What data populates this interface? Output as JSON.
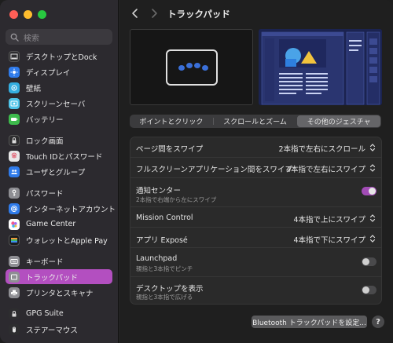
{
  "window": {
    "title": "トラックパッド"
  },
  "sidebar": {
    "search_placeholder": "検索",
    "items": [
      {
        "label": "デスクトップとDock",
        "icon": "dock-icon",
        "color": "#2d2d2f"
      },
      {
        "label": "ディスプレイ",
        "icon": "display-icon",
        "color": "#2f7bea"
      },
      {
        "label": "壁紙",
        "icon": "wallpaper-icon",
        "color": "#34aee0"
      },
      {
        "label": "スクリーンセーバ",
        "icon": "screensaver-icon",
        "color": "#4fc4e8"
      },
      {
        "label": "バッテリー",
        "icon": "battery-icon",
        "color": "#3dbb4c"
      },
      {
        "label": "ロック画面",
        "icon": "lock-icon",
        "color": "#2d2d2f"
      },
      {
        "label": "Touch IDとパスワード",
        "icon": "fingerprint-icon",
        "color": "#e8e8e8"
      },
      {
        "label": "ユーザとグループ",
        "icon": "users-icon",
        "color": "#2f7bea"
      },
      {
        "label": "パスワード",
        "icon": "key-icon",
        "color": "#8e8e93"
      },
      {
        "label": "インターネットアカウント",
        "icon": "at-icon",
        "color": "#2f7bea"
      },
      {
        "label": "Game Center",
        "icon": "game-center-icon",
        "color": "#ffffff"
      },
      {
        "label": "ウォレットとApple Pay",
        "icon": "wallet-icon",
        "color": "#1c1c1e"
      },
      {
        "label": "キーボード",
        "icon": "keyboard-icon",
        "color": "#8e8e93"
      },
      {
        "label": "トラックパッド",
        "icon": "trackpad-icon",
        "color": "#8e8e93",
        "active": true
      },
      {
        "label": "プリンタとスキャナ",
        "icon": "printer-icon",
        "color": "#8e8e93"
      },
      {
        "label": "GPG Suite",
        "icon": "gpg-lock-icon",
        "color": "#2d2d2f"
      },
      {
        "label": "ステアーマウス",
        "icon": "mouse-icon",
        "color": "#2d2d2f"
      }
    ]
  },
  "tabs": [
    {
      "label": "ポイントとクリック",
      "active": false
    },
    {
      "label": "スクロールとズーム",
      "active": false
    },
    {
      "label": "その他のジェスチャ",
      "active": true
    }
  ],
  "settings": [
    {
      "label": "ページ間をスワイプ",
      "value": "2本指で左右にスクロール",
      "type": "popup"
    },
    {
      "label": "フルスクリーンアプリケーション間をスワイプ",
      "value": "4本指で左右にスワイプ",
      "type": "popup"
    },
    {
      "label": "通知センター",
      "sub": "2本指で右端から左にスワイプ",
      "type": "toggle",
      "on": true
    },
    {
      "label": "Mission Control",
      "value": "4本指で上にスワイプ",
      "type": "popup"
    },
    {
      "label": "アプリ Exposé",
      "value": "4本指で下にスワイプ",
      "type": "popup"
    },
    {
      "label": "Launchpad",
      "sub": "親指と3本指でピンチ",
      "type": "toggle",
      "on": false
    },
    {
      "label": "デスクトップを表示",
      "sub": "親指と3本指で広げる",
      "type": "toggle",
      "on": false
    }
  ],
  "footer": {
    "bluetooth_button": "Bluetooth トラックパッドを設定...",
    "help": "?"
  },
  "colors": {
    "accent": "#b34fc0",
    "toggle_on": "#a24cb6"
  }
}
